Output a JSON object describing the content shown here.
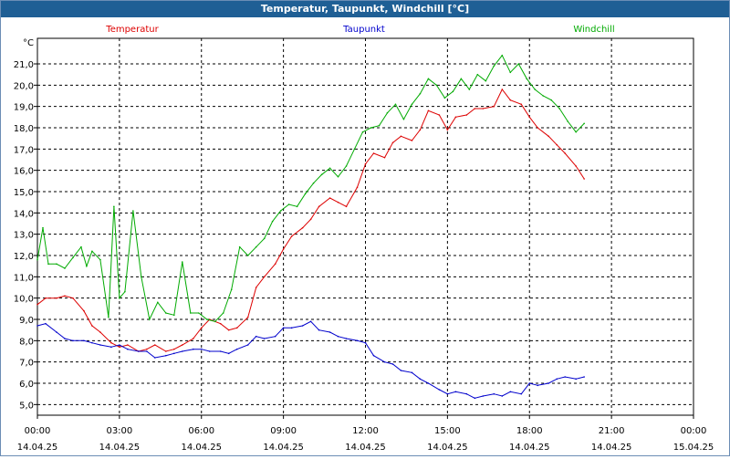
{
  "window": {
    "title": "Temperatur, Taupunkt, Windchill [°C]"
  },
  "chart_data": {
    "type": "line",
    "title": "Temperatur, Taupunkt, Windchill [°C]",
    "ylabel": "°C",
    "xlabel": "",
    "ylim": [
      4.5,
      22.2
    ],
    "xlim": [
      0,
      24
    ],
    "y_ticks": [
      5.0,
      6.0,
      7.0,
      8.0,
      9.0,
      10.0,
      11.0,
      12.0,
      13.0,
      14.0,
      15.0,
      16.0,
      17.0,
      18.0,
      19.0,
      20.0,
      21.0
    ],
    "y_tick_labels": [
      "5,0",
      "6,0",
      "7,0",
      "8,0",
      "9,0",
      "10,0",
      "11,0",
      "12,0",
      "13,0",
      "14,0",
      "15,0",
      "16,0",
      "17,0",
      "18,0",
      "19,0",
      "20,0",
      "21,0"
    ],
    "x_ticks": [
      0,
      3,
      6,
      9,
      12,
      15,
      18,
      21,
      24
    ],
    "x_tick_labels": [
      [
        "00:00",
        "14.04.25"
      ],
      [
        "03:00",
        "14.04.25"
      ],
      [
        "06:00",
        "14.04.25"
      ],
      [
        "09:00",
        "14.04.25"
      ],
      [
        "12:00",
        "14.04.25"
      ],
      [
        "15:00",
        "14.04.25"
      ],
      [
        "18:00",
        "14.04.25"
      ],
      [
        "21:00",
        "14.04.25"
      ],
      [
        "00:00",
        "15.04.25"
      ]
    ],
    "grid": true,
    "legend": "top",
    "series": [
      {
        "name": "Temperatur",
        "color": "#dd0000",
        "x": [
          0,
          0.3,
          0.7,
          1.0,
          1.3,
          1.7,
          2.0,
          2.3,
          2.7,
          3.0,
          3.3,
          3.7,
          4.0,
          4.3,
          4.7,
          5.0,
          5.3,
          5.7,
          6.0,
          6.3,
          6.7,
          7.0,
          7.3,
          7.7,
          8.0,
          8.3,
          8.7,
          9.0,
          9.3,
          9.7,
          10.0,
          10.3,
          10.7,
          11.0,
          11.3,
          11.7,
          12.0,
          12.3,
          12.7,
          13.0,
          13.3,
          13.7,
          14.0,
          14.3,
          14.7,
          15.0,
          15.3,
          15.7,
          16.0,
          16.3,
          16.7,
          17.0,
          17.3,
          17.7,
          18.0,
          18.3,
          18.7,
          19.0,
          19.3,
          19.7,
          20.0
        ],
        "values": [
          9.7,
          10.0,
          10.0,
          10.1,
          10.0,
          9.4,
          8.7,
          8.4,
          7.9,
          7.7,
          7.8,
          7.5,
          7.6,
          7.8,
          7.5,
          7.6,
          7.8,
          8.1,
          8.6,
          9.0,
          8.8,
          8.5,
          8.6,
          9.1,
          10.5,
          11.0,
          11.6,
          12.3,
          12.9,
          13.3,
          13.7,
          14.3,
          14.7,
          14.5,
          14.3,
          15.2,
          16.3,
          16.8,
          16.6,
          17.3,
          17.6,
          17.4,
          17.9,
          18.8,
          18.6,
          17.9,
          18.5,
          18.6,
          18.9,
          18.9,
          19.0,
          19.8,
          19.3,
          19.1,
          18.5,
          18.0,
          17.6,
          17.2,
          16.8,
          16.2,
          15.6
        ]
      },
      {
        "name": "Taupunkt",
        "color": "#0000cc",
        "x": [
          0,
          0.3,
          0.7,
          1.0,
          1.3,
          1.7,
          2.0,
          2.3,
          2.7,
          3.0,
          3.3,
          3.7,
          4.0,
          4.3,
          4.7,
          5.0,
          5.3,
          5.7,
          6.0,
          6.3,
          6.7,
          7.0,
          7.3,
          7.7,
          8.0,
          8.3,
          8.7,
          9.0,
          9.3,
          9.7,
          10.0,
          10.3,
          10.7,
          11.0,
          11.3,
          11.7,
          12.0,
          12.3,
          12.7,
          13.0,
          13.3,
          13.7,
          14.0,
          14.3,
          14.7,
          15.0,
          15.3,
          15.7,
          16.0,
          16.3,
          16.7,
          17.0,
          17.3,
          17.7,
          18.0,
          18.3,
          18.7,
          19.0,
          19.3,
          19.7,
          20.0
        ],
        "values": [
          8.7,
          8.8,
          8.4,
          8.1,
          8.0,
          8.0,
          7.9,
          7.8,
          7.7,
          7.8,
          7.6,
          7.5,
          7.5,
          7.2,
          7.3,
          7.4,
          7.5,
          7.6,
          7.6,
          7.5,
          7.5,
          7.4,
          7.6,
          7.8,
          8.2,
          8.1,
          8.2,
          8.6,
          8.6,
          8.7,
          8.9,
          8.5,
          8.4,
          8.2,
          8.1,
          8.0,
          7.9,
          7.3,
          7.0,
          6.9,
          6.6,
          6.5,
          6.2,
          6.0,
          5.7,
          5.5,
          5.6,
          5.5,
          5.3,
          5.4,
          5.5,
          5.4,
          5.6,
          5.5,
          6.0,
          5.9,
          6.0,
          6.2,
          6.3,
          6.2,
          6.3
        ]
      },
      {
        "name": "Windchill",
        "color": "#00aa00",
        "x": [
          0,
          0.2,
          0.4,
          0.7,
          1.0,
          1.3,
          1.6,
          1.8,
          2.0,
          2.3,
          2.6,
          2.8,
          3.0,
          3.2,
          3.5,
          3.8,
          4.1,
          4.4,
          4.7,
          5.0,
          5.3,
          5.6,
          5.9,
          6.2,
          6.5,
          6.8,
          7.1,
          7.4,
          7.7,
          8.0,
          8.3,
          8.6,
          8.9,
          9.2,
          9.5,
          9.8,
          10.1,
          10.4,
          10.7,
          11.0,
          11.3,
          11.6,
          11.9,
          12.2,
          12.5,
          12.8,
          13.1,
          13.4,
          13.7,
          14.0,
          14.3,
          14.6,
          14.9,
          15.2,
          15.5,
          15.8,
          16.1,
          16.4,
          16.7,
          17.0,
          17.3,
          17.6,
          17.9,
          18.2,
          18.5,
          18.8,
          19.1,
          19.4,
          19.7,
          20.0
        ],
        "values": [
          11.8,
          13.3,
          11.6,
          11.6,
          11.4,
          11.9,
          12.4,
          11.5,
          12.2,
          11.8,
          9.1,
          14.3,
          10.0,
          10.3,
          14.1,
          11.0,
          9.0,
          9.8,
          9.3,
          9.2,
          11.7,
          9.3,
          9.3,
          9.0,
          8.9,
          9.3,
          10.4,
          12.4,
          12.0,
          12.4,
          12.8,
          13.6,
          14.1,
          14.4,
          14.3,
          14.9,
          15.4,
          15.8,
          16.1,
          15.7,
          16.2,
          17.0,
          17.8,
          18.0,
          18.1,
          18.7,
          19.1,
          18.4,
          19.1,
          19.6,
          20.3,
          20.0,
          19.4,
          19.7,
          20.3,
          19.8,
          20.5,
          20.2,
          20.9,
          21.4,
          20.6,
          21.0,
          20.3,
          19.8,
          19.5,
          19.3,
          18.9,
          18.3,
          17.8,
          18.2
        ]
      }
    ]
  }
}
